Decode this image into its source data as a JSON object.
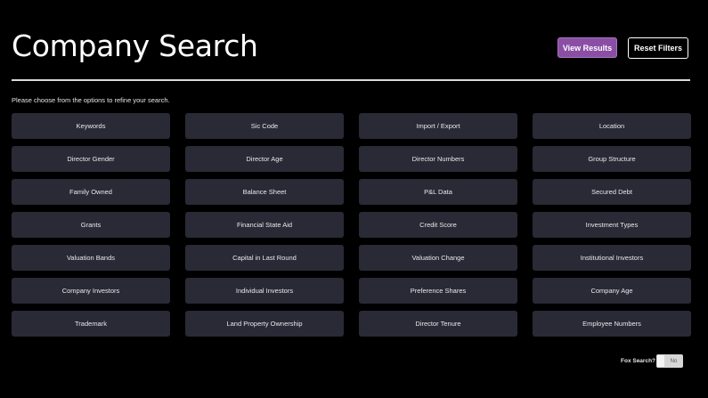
{
  "header": {
    "title": "Company Search",
    "view_results_label": "View Results",
    "reset_filters_label": "Reset Filters"
  },
  "instructions": "Please choose from the options to refine your search.",
  "filters": [
    "Keywords",
    "Sic Code",
    "Import / Export",
    "Location",
    "Director Gender",
    "Director Age",
    "Director Numbers",
    "Group Structure",
    "Family Owned",
    "Balance Sheet",
    "P&L Data",
    "Secured Debt",
    "Grants",
    "Financial State Aid",
    "Credit Score",
    "Investment Types",
    "Valuation Bands",
    "Capital in Last Round",
    "Valuation Change",
    "Institutional Investors",
    "Company Investors",
    "Individual Investors",
    "Preference Shares",
    "Company Age",
    "Trademark",
    "Land Property Ownership",
    "Director Tenure",
    "Employee Numbers"
  ],
  "fox_search": {
    "label": "Fox Search?",
    "value": "No"
  },
  "colors": {
    "background": "#000000",
    "button_primary": "#8a4fa5",
    "filter_tile": "#2a2a36",
    "divider": "#d9d9d9"
  }
}
